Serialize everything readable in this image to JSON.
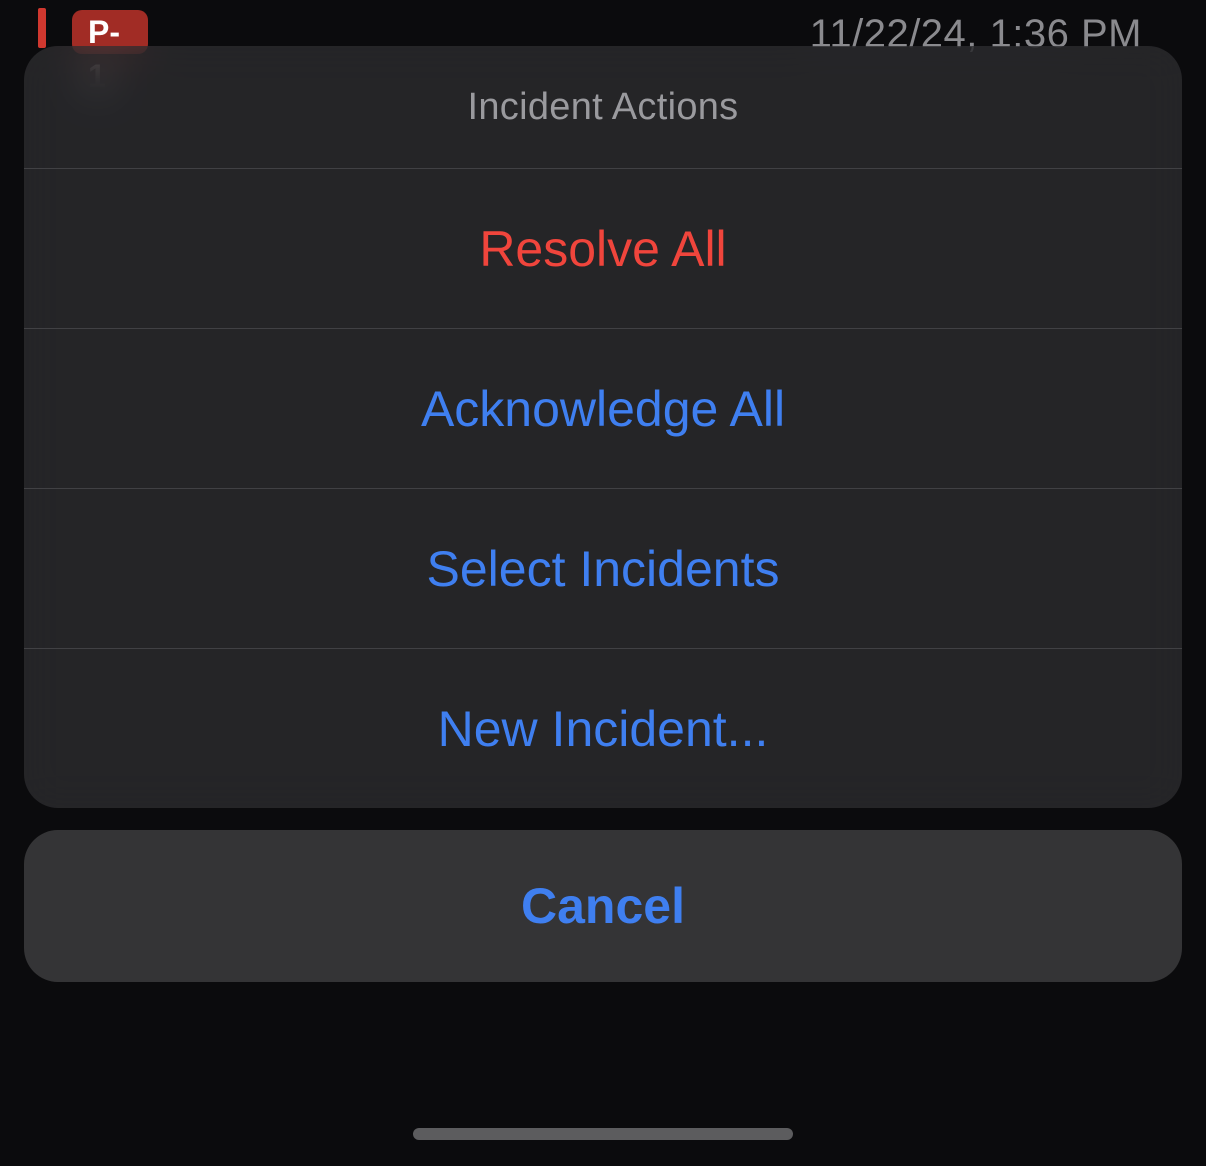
{
  "background": {
    "priority_label": "P-1",
    "timestamp": "11/22/24, 1:36 PM"
  },
  "action_sheet": {
    "title": "Incident Actions",
    "actions": {
      "resolve_all": {
        "label": "Resolve All",
        "style": "red"
      },
      "acknowledge_all": {
        "label": "Acknowledge All",
        "style": "blue"
      },
      "select_incidents": {
        "label": "Select Incidents",
        "style": "blue"
      },
      "new_incident": {
        "label": "New Incident...",
        "style": "blue"
      }
    },
    "cancel_label": "Cancel"
  }
}
